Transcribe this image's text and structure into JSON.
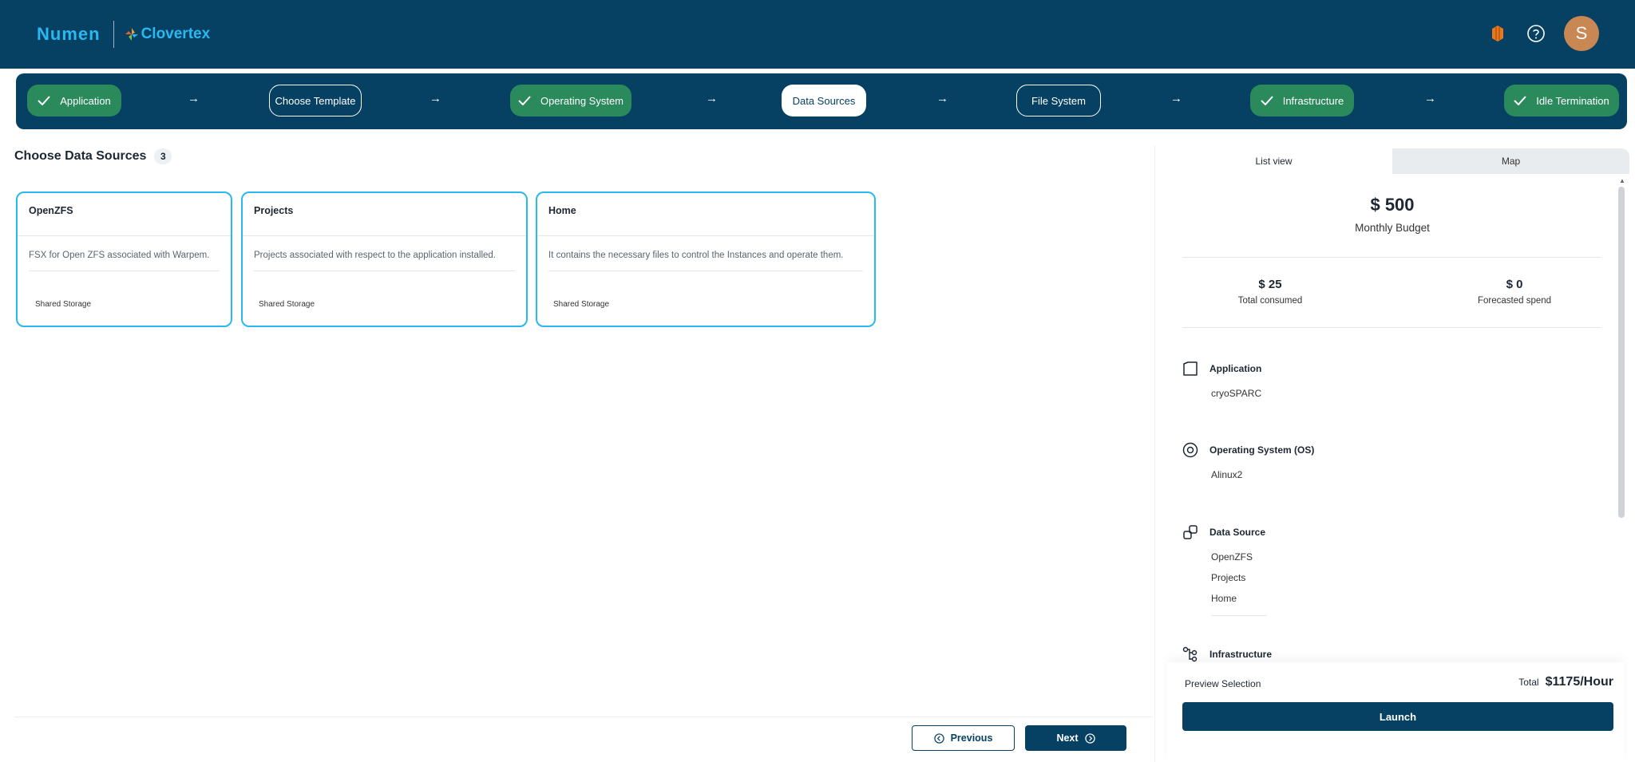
{
  "brand": {
    "numen": "Numen",
    "clovertex": "Clovertex"
  },
  "header": {
    "avatar_initial": "S",
    "icons": [
      "layers-icon",
      "help-icon"
    ]
  },
  "stepper": {
    "steps": [
      {
        "label": "Application",
        "state": "done"
      },
      {
        "label": "Choose Template",
        "state": "outline"
      },
      {
        "label": "Operating System",
        "state": "done"
      },
      {
        "label": "Data Sources",
        "state": "active"
      },
      {
        "label": "File System",
        "state": "outline"
      },
      {
        "label": "Infrastructure",
        "state": "done"
      },
      {
        "label": "Idle Termination",
        "state": "done"
      }
    ],
    "arrow": "→"
  },
  "main": {
    "title": "Choose Data Sources",
    "count": "3",
    "cards": [
      {
        "title": "OpenZFS",
        "description": "FSX for Open ZFS associated with Warpem.",
        "tag": "Shared Storage"
      },
      {
        "title": "Projects",
        "description": "Projects associated with respect to the application installed.",
        "tag": "Shared Storage"
      },
      {
        "title": "Home",
        "description": "It contains the necessary files to control the Instances and operate them.",
        "tag": "Shared Storage"
      }
    ],
    "previous_label": "Previous",
    "next_label": "Next"
  },
  "panel": {
    "tabs": [
      "List view",
      "Map"
    ],
    "budget": {
      "amount": "$ 500",
      "label": "Monthly Budget"
    },
    "consumed": {
      "value": "$ 25",
      "label": "Total consumed"
    },
    "forecast": {
      "value": "$ 0",
      "label": "Forecasted spend"
    },
    "sections": {
      "application": {
        "title": "Application",
        "items": [
          "cryoSPARC"
        ]
      },
      "os": {
        "title": "Operating System (OS)",
        "items": [
          "Alinux2"
        ]
      },
      "data_source": {
        "title": "Data Source",
        "items": [
          "OpenZFS",
          "Projects",
          "Home"
        ]
      },
      "infrastructure": {
        "title": "Infrastructure"
      }
    },
    "preview_label": "Preview Selection",
    "total_label": "Total",
    "total_value": "$1175/Hour",
    "launch_label": "Launch"
  },
  "colors": {
    "primary": "#064062",
    "accent": "#2ab8f0",
    "success": "#2a8a5c"
  }
}
